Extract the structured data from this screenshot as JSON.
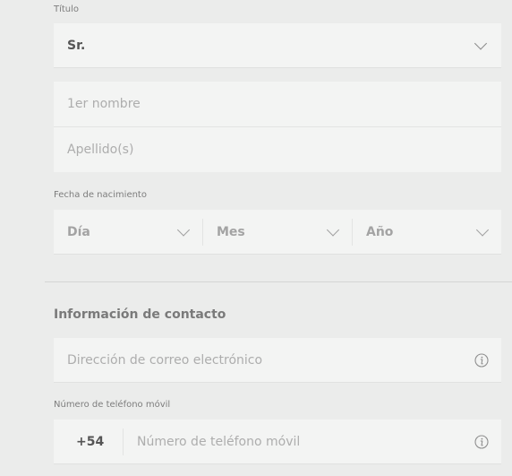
{
  "title_field": {
    "label": "Título",
    "value": "Sr."
  },
  "name_group": {
    "first_name_placeholder": "1er nombre",
    "last_name_placeholder": "Apellido(s)"
  },
  "birth_date": {
    "label": "Fecha de nacimiento",
    "day_placeholder": "Día",
    "month_placeholder": "Mes",
    "year_placeholder": "Año"
  },
  "contact": {
    "section_title": "Información de contacto",
    "email_placeholder": "Dirección de correo electrónico",
    "phone_label": "Número de teléfono móvil",
    "country_code": "+54",
    "phone_placeholder": "Número de teléfono móvil"
  },
  "icons": {
    "dropdown": "chevron-down-icon",
    "info": "info-icon"
  },
  "colors": {
    "background": "#ebeceb",
    "field_background": "#f3f4f3",
    "placeholder_text": "#adadad",
    "value_text": "#555555"
  }
}
